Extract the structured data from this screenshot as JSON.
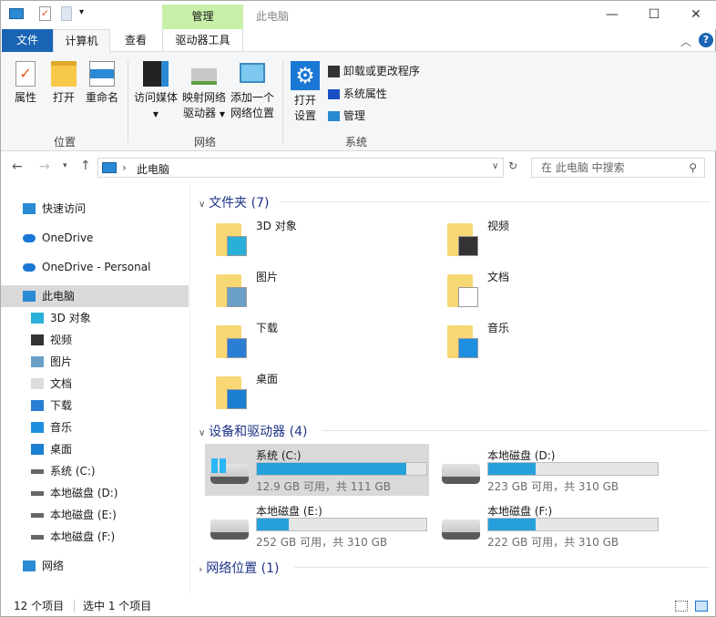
{
  "window": {
    "title": "此电脑",
    "context_tab": "管理",
    "minimize": "—",
    "maximize": "☐",
    "close": "✕"
  },
  "tabs": {
    "file": "文件",
    "computer": "计算机",
    "view": "查看",
    "drive_tools": "驱动器工具"
  },
  "ribbon": {
    "location": {
      "label": "位置",
      "properties": "属性",
      "open": "打开",
      "rename": "重命名"
    },
    "network": {
      "label": "网络",
      "access_media": "访问媒体",
      "map_drive_1": "映射网络",
      "map_drive_2": "驱动器",
      "add_location_1": "添加一个",
      "add_location_2": "网络位置"
    },
    "system": {
      "label": "系统",
      "open_settings_1": "打开",
      "open_settings_2": "设置",
      "uninstall": "卸载或更改程序",
      "sys_props": "系统属性",
      "manage": "管理"
    }
  },
  "address": {
    "path": "此电脑",
    "search_placeholder": "在 此电脑 中搜索"
  },
  "nav": [
    {
      "label": "快速访问",
      "icon": "star-icon"
    },
    {
      "label": "OneDrive",
      "icon": "cloud-icon"
    },
    {
      "label": "OneDrive - Personal",
      "icon": "cloud-icon"
    },
    {
      "label": "此电脑",
      "icon": "computer-icon"
    },
    {
      "label": "3D 对象",
      "icon": "cube-icon"
    },
    {
      "label": "视频",
      "icon": "video-icon"
    },
    {
      "label": "图片",
      "icon": "picture-icon"
    },
    {
      "label": "文档",
      "icon": "document-icon"
    },
    {
      "label": "下载",
      "icon": "download-icon"
    },
    {
      "label": "音乐",
      "icon": "music-icon"
    },
    {
      "label": "桌面",
      "icon": "desktop-icon"
    },
    {
      "label": "系统 (C:)",
      "icon": "drive-icon"
    },
    {
      "label": "本地磁盘 (D:)",
      "icon": "drive-icon"
    },
    {
      "label": "本地磁盘 (E:)",
      "icon": "drive-icon"
    },
    {
      "label": "本地磁盘 (F:)",
      "icon": "drive-icon"
    },
    {
      "label": "网络",
      "icon": "network-icon"
    }
  ],
  "sections": {
    "folders": "文件夹 (7)",
    "devices": "设备和驱动器 (4)",
    "network": "网络位置 (1)"
  },
  "folders": [
    {
      "label": "3D 对象",
      "color": "#2ab0d8"
    },
    {
      "label": "视频",
      "color": "#333333"
    },
    {
      "label": "图片",
      "color": "#6aa0c8"
    },
    {
      "label": "文档",
      "color": "#ffffff"
    },
    {
      "label": "下载",
      "color": "#2a7fd4"
    },
    {
      "label": "音乐",
      "color": "#1e8fe0"
    },
    {
      "label": "桌面",
      "color": "#1a7fd0"
    }
  ],
  "drives": [
    {
      "name": "系统 (C:)",
      "free": "12.9 GB 可用，共 111 GB",
      "used_fraction": 0.884
    },
    {
      "name": "本地磁盘 (D:)",
      "free": "223 GB 可用，共 310 GB",
      "used_fraction": 0.28
    },
    {
      "name": "本地磁盘 (E:)",
      "free": "252 GB 可用，共 310 GB",
      "used_fraction": 0.19
    },
    {
      "name": "本地磁盘 (F:)",
      "free": "222 GB 可用，共 310 GB",
      "used_fraction": 0.28
    }
  ],
  "status": {
    "count": "12 个项目",
    "selected": "选中 1 个项目"
  }
}
